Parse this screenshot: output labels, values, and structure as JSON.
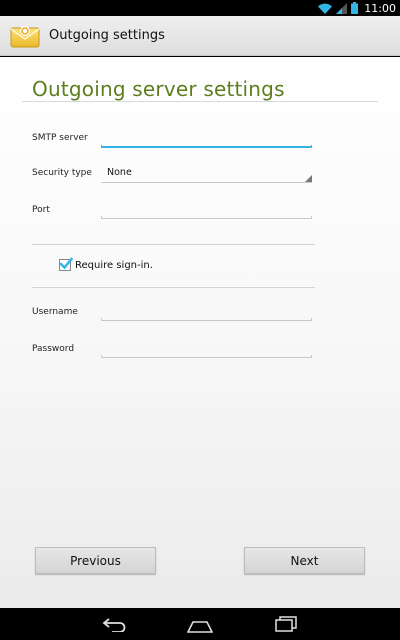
{
  "status_bar": {
    "time": "11:00",
    "icons": [
      "wifi-icon",
      "signal-icon",
      "battery-icon"
    ]
  },
  "action_bar": {
    "title": "Outgoing settings",
    "icon": "email-app-icon"
  },
  "main": {
    "page_title": "Outgoing server settings",
    "fields": {
      "smtp_server": {
        "label": "SMTP server",
        "value": ""
      },
      "security_type": {
        "label": "Security type",
        "value": "None"
      },
      "port": {
        "label": "Port",
        "value": ""
      },
      "username": {
        "label": "Username",
        "value": ""
      },
      "password": {
        "label": "Password",
        "value": ""
      }
    },
    "require_signin": {
      "label": "Require sign-in.",
      "checked": true
    }
  },
  "buttons": {
    "previous": "Previous",
    "next": "Next"
  },
  "nav_bar": {
    "icons": [
      "back-icon",
      "home-icon",
      "recent-apps-icon"
    ]
  },
  "colors": {
    "accent_green": "#5d7e1f",
    "focus_blue": "#33b5e5",
    "checkbox_blue": "#33b5e5"
  }
}
